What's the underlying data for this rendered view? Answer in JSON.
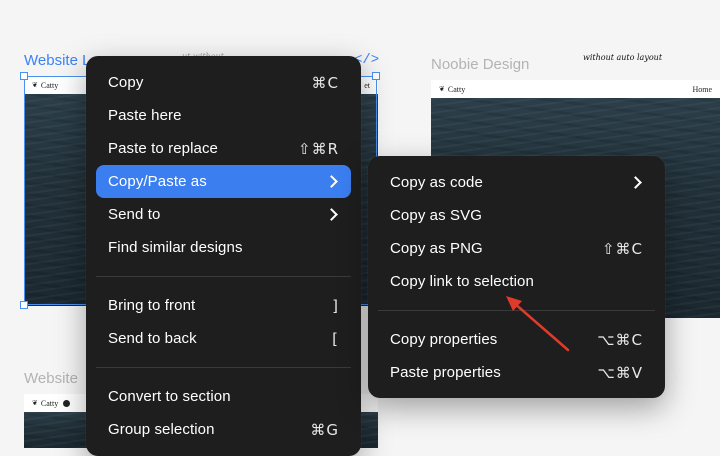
{
  "canvas": {
    "frames": {
      "left": {
        "label": "Website L",
        "brand": "Catty",
        "nav_right": "et"
      },
      "right": {
        "label": "Noobie Design",
        "brand": "Catty",
        "nav_right": "Home",
        "note": "without auto layout"
      },
      "bottom": {
        "label": "Website",
        "brand": "Catty"
      }
    },
    "code_tag": "</>",
    "colors": {
      "selection": "#4a90f0",
      "sea": "#22323b"
    }
  },
  "context_menu": {
    "groups": [
      [
        {
          "label": "Copy",
          "shortcut": "⌘C"
        },
        {
          "label": "Paste here",
          "shortcut": ""
        },
        {
          "label": "Paste to replace",
          "shortcut": "⇧⌘R"
        },
        {
          "label": "Copy/Paste as",
          "submenu": true,
          "active": true
        },
        {
          "label": "Send to",
          "submenu": true
        },
        {
          "label": "Find similar designs",
          "shortcut": ""
        }
      ],
      [
        {
          "label": "Bring to front",
          "shortcut": "]"
        },
        {
          "label": "Send to back",
          "shortcut": "["
        }
      ],
      [
        {
          "label": "Convert to section",
          "shortcut": ""
        },
        {
          "label": "Group selection",
          "shortcut": "⌘G"
        }
      ]
    ]
  },
  "submenu": {
    "groups": [
      [
        {
          "label": "Copy as code",
          "submenu": true
        },
        {
          "label": "Copy as SVG",
          "shortcut": ""
        },
        {
          "label": "Copy as PNG",
          "shortcut": "⇧⌘C"
        },
        {
          "label": "Copy link to selection",
          "shortcut": ""
        }
      ],
      [
        {
          "label": "Copy properties",
          "shortcut": "⌥⌘C"
        },
        {
          "label": "Paste properties",
          "shortcut": "⌥⌘V"
        }
      ]
    ]
  },
  "annotation": {
    "arrow_color": "#e03b2a"
  },
  "theme": {
    "menu_bg": "#1e1e1e",
    "accent": "#3b7ef0"
  }
}
